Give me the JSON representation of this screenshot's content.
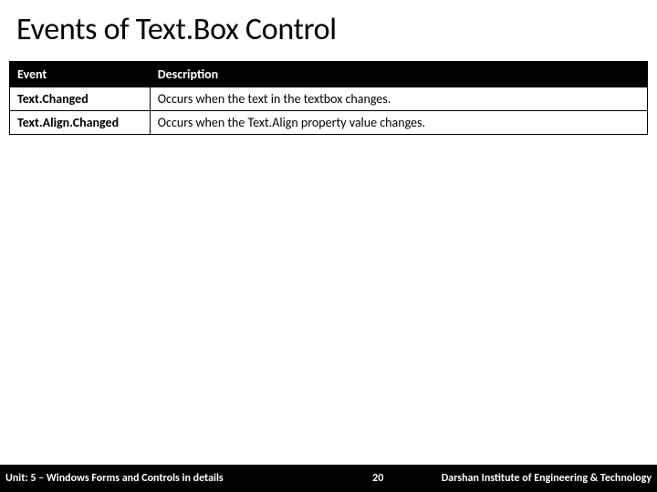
{
  "title": "Events of Text.Box Control",
  "table": {
    "headers": {
      "event": "Event",
      "description": "Description"
    },
    "rows": [
      {
        "event": "Text.Changed",
        "description": "Occurs when the text in the textbox changes."
      },
      {
        "event": "Text.Align.Changed",
        "description": "Occurs when the Text.Align property value changes."
      }
    ]
  },
  "footer": {
    "unit": "Unit: 5 – Windows Forms and Controls in details",
    "page": "20",
    "institute": "Darshan Institute of Engineering & Technology"
  }
}
